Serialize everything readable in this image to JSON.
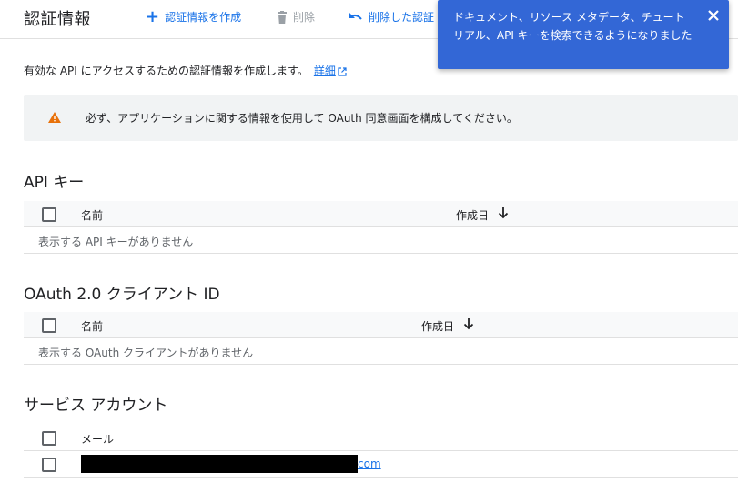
{
  "header": {
    "title": "認証情報",
    "create_label": "認証情報を作成",
    "delete_label": "削除",
    "restore_label": "削除した認証"
  },
  "description": {
    "text": "有効な API にアクセスするための認証情報を作成します。",
    "link_label": "詳細"
  },
  "warning": {
    "text": "必ず、アプリケーションに関する情報を使用して OAuth 同意画面を構成してください。"
  },
  "api_keys": {
    "title": "API キー",
    "col_name": "名前",
    "col_created": "作成日",
    "empty": "表示する API キーがありません"
  },
  "oauth": {
    "title": "OAuth 2.0 クライアント ID",
    "col_name": "名前",
    "col_created": "作成日",
    "empty": "表示する OAuth クライアントがありません"
  },
  "service_accounts": {
    "title": "サービス アカウント",
    "col_email": "メール",
    "rows": [
      {
        "email_visible": "com"
      }
    ]
  },
  "toast": {
    "text": "ドキュメント、リソース メタデータ、チュートリアル、API キーを検索できるようになりました"
  },
  "colors": {
    "accent": "#1a73e8",
    "toast_bg": "#3367d6",
    "warning": "#e8710a",
    "disabled": "#9aa0a6"
  },
  "icons": {
    "create": "plus-icon",
    "delete": "trash-icon",
    "restore": "undo-icon",
    "external": "external-link-icon",
    "warning": "warning-icon",
    "sort": "arrow-down-icon",
    "close": "close-icon"
  }
}
